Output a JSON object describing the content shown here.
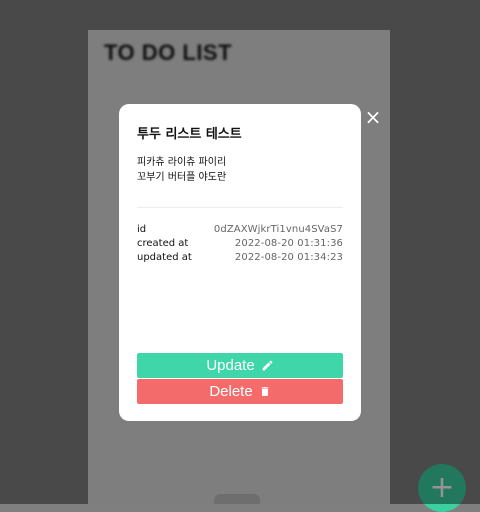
{
  "app": {
    "title": "TO DO LIST",
    "fab_label": "+"
  },
  "modal": {
    "title": "투두 리스트 테스트",
    "body_lines": [
      "피카츄 라이츄 파이리",
      "꼬부기 버터플 야도란"
    ],
    "close_label": "×",
    "meta": [
      {
        "key": "id",
        "value": "0dZAXWjkrTi1vnu4SVaS7"
      },
      {
        "key": "created at",
        "value": "2022-08-20 01:31:36"
      },
      {
        "key": "updated at",
        "value": "2022-08-20 01:34:23"
      }
    ],
    "update_label": "Update",
    "delete_label": "Delete"
  },
  "colors": {
    "accent_green": "#3fd6a9",
    "danger_red": "#f36c6b",
    "overlay": "rgba(0,0,0,0.42)"
  },
  "icons": {
    "update": "pencil-icon",
    "delete": "trash-icon",
    "close": "close-icon",
    "fab": "plus-icon"
  }
}
